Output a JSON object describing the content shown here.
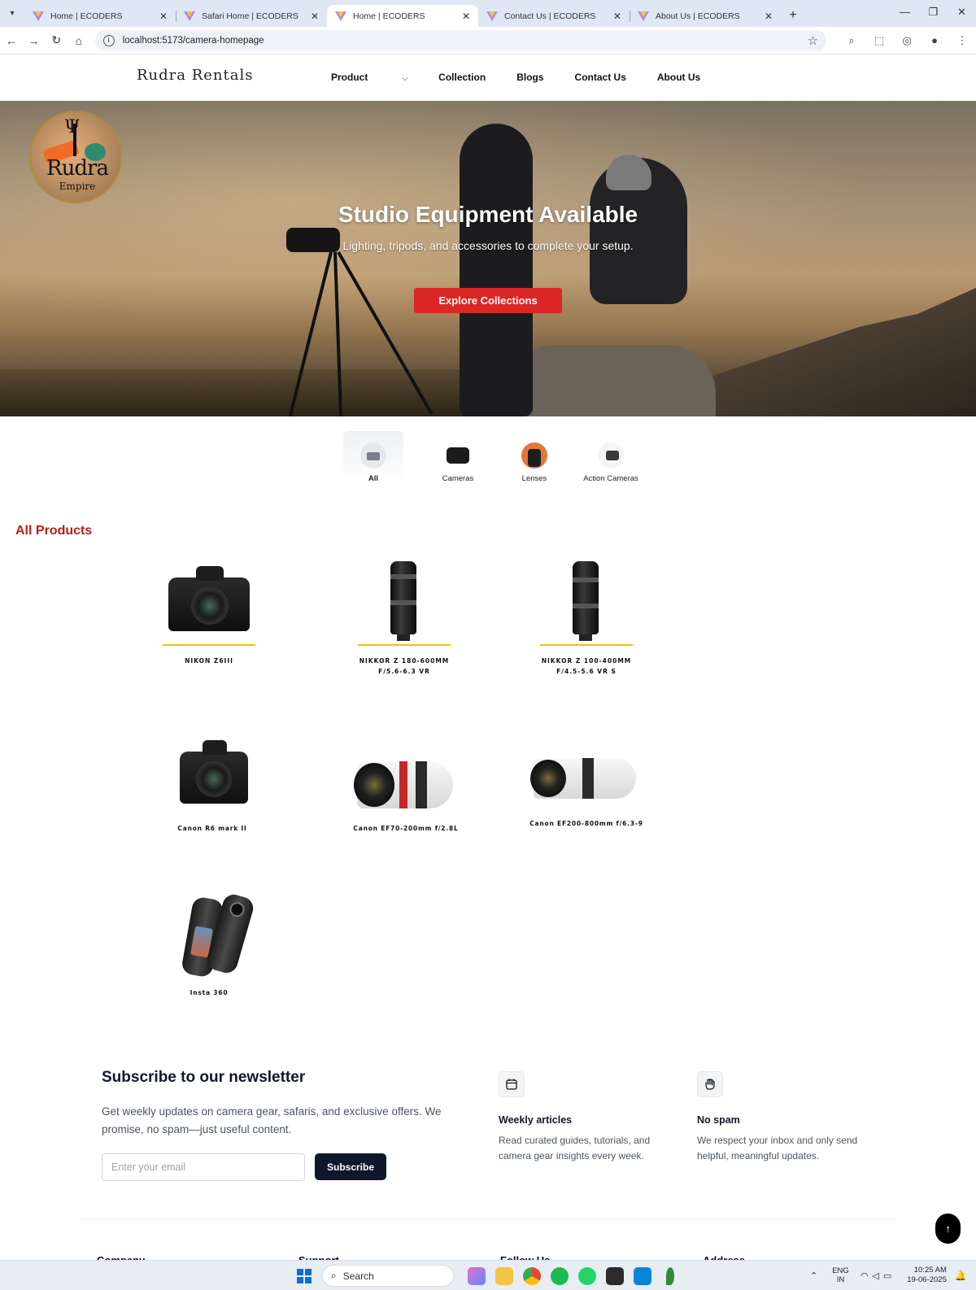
{
  "browser": {
    "tabs": [
      {
        "title": "Home | ECODERS",
        "active": false
      },
      {
        "title": "Safari Home | ECODERS",
        "active": false
      },
      {
        "title": "Home | ECODERS",
        "active": true
      },
      {
        "title": "Contact Us | ECODERS",
        "active": false
      },
      {
        "title": "About Us | ECODERS",
        "active": false
      }
    ],
    "url": "localhost:5173/camera-homepage"
  },
  "site": {
    "brand": "Rudra Rentals",
    "nav": [
      "Product",
      "Collection",
      "Blogs",
      "Contact Us",
      "About Us"
    ]
  },
  "hero": {
    "logo_name": "Rudra",
    "logo_sub": "Empire",
    "title": "Studio Equipment Available",
    "subtitle": "Lighting, tripods, and accessories to complete your setup.",
    "cta": "Explore Collections"
  },
  "categories": [
    {
      "label": "All",
      "active": true
    },
    {
      "label": "Cameras",
      "active": false
    },
    {
      "label": "Lenses",
      "active": false
    },
    {
      "label": "Action Cameras",
      "active": false
    }
  ],
  "products_section": {
    "title": "All Products",
    "items": [
      {
        "name": "NIKON Z6III"
      },
      {
        "name": "NIKKOR Z 180-600MM F/5.6-6.3 VR"
      },
      {
        "name": "NIKKOR Z 100-400MM F/4.5-5.6 VR S"
      },
      {
        "name": "Canon R6 mark II"
      },
      {
        "name": "Canon EF70-200mm f/2.8L"
      },
      {
        "name": "Canon EF200-800mm f/6.3-9"
      },
      {
        "name": "Insta 360"
      }
    ]
  },
  "newsletter": {
    "title": "Subscribe to our newsletter",
    "text": "Get weekly updates on camera gear, safaris, and exclusive offers. We promise, no spam—just useful content.",
    "placeholder": "Enter your email",
    "button": "Subscribe",
    "features": [
      {
        "icon": "calendar-icon",
        "title": "Weekly articles",
        "text": "Read curated guides, tutorials, and camera gear insights every week."
      },
      {
        "icon": "hand-icon",
        "title": "No spam",
        "text": "We respect your inbox and only send helpful, meaningful updates."
      }
    ]
  },
  "footer": {
    "columns": [
      "Company",
      "Support",
      "Follow Us",
      "Address"
    ]
  },
  "taskbar": {
    "search": "Search",
    "lang_line1": "ENG",
    "lang_line2": "IN",
    "time": "10:25 AM",
    "date": "19-06-2025"
  },
  "colors": {
    "accent_red": "#db2626",
    "section_title": "#b91c1c",
    "product_underline": "#f2c200",
    "subscribe_button": "#0f172a"
  }
}
